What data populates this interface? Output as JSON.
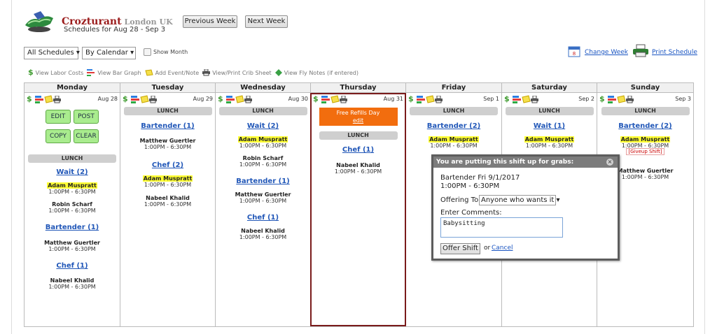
{
  "header": {
    "brand": "Crozturant",
    "location": "London UK",
    "subtitle": "Schedules for Aug 28 - Sep 3",
    "prev_label": "Previous Week",
    "next_label": "Next Week"
  },
  "controls": {
    "schedules_select": "All Schedules",
    "view_select": "By Calendar",
    "show_month_label": "Show Month",
    "change_week_label": "Change Week",
    "print_schedule_label": "Print Schedule"
  },
  "toolbar": {
    "labor": "View Labor Costs",
    "bar": "View Bar Graph",
    "event": "Add Event/Note",
    "crib": "View/Print Crib Sheet",
    "fly": "View Fly Notes (if entered)"
  },
  "days": [
    {
      "name": "Monday",
      "date": "Aug 28"
    },
    {
      "name": "Tuesday",
      "date": "Aug 29"
    },
    {
      "name": "Wednesday",
      "date": "Aug 30"
    },
    {
      "name": "Thursday",
      "date": "Aug 31"
    },
    {
      "name": "Friday",
      "date": "Sep 1"
    },
    {
      "name": "Saturday",
      "date": "Sep 2"
    },
    {
      "name": "Sunday",
      "date": "Sep 3"
    }
  ],
  "lunch": "LUNCH",
  "monday_buttons": {
    "edit": "EDIT",
    "post": "POST",
    "copy": "COPY",
    "clear": "CLEAR"
  },
  "shifts": {
    "mon": {
      "wait": "Wait (2)",
      "e1": "Adam Muspratt",
      "t1": "1:00PM - 6:30PM",
      "e2": "Robin Scharf",
      "t2": "1:00PM - 6:30PM",
      "bart": "Bartender (1)",
      "e3": "Matthew Guertler",
      "t3": "1:00PM - 6:30PM",
      "chef": "Chef (1)",
      "e4": "Nabeel Khalid",
      "t4": "1:00PM - 6:30PM"
    },
    "tue": {
      "bart": "Bartender (1)",
      "e1": "Matthew Guertler",
      "t1": "1:00PM - 6:30PM",
      "chef": "Chef (2)",
      "e2": "Adam Muspratt",
      "t2": "1:00PM - 6:30PM",
      "e3": "Nabeel Khalid",
      "t3": "1:00PM - 6:30PM"
    },
    "wed": {
      "wait": "Wait (2)",
      "e1": "Adam Muspratt",
      "t1": "1:00PM - 6:30PM",
      "e2": "Robin Scharf",
      "t2": "1:00PM - 6:30PM",
      "bart": "Bartender (1)",
      "e3": "Matthew Guertler",
      "t3": "1:00PM - 6:30PM",
      "chef": "Chef (1)",
      "e4": "Nabeel Khalid",
      "t4": "1:00PM - 6:30PM"
    },
    "thu": {
      "event": "Free Refills Day",
      "event_edit": "edit",
      "chef": "Chef (1)",
      "e1": "Nabeel Khalid",
      "t1": "1:00PM - 6:30PM"
    },
    "fri": {
      "bart": "Bartender (2)",
      "e1": "Adam Muspratt",
      "t1": "1:00PM - 6:30PM"
    },
    "sat": {
      "wait": "Wait (1)",
      "e1": "Adam Muspratt",
      "t1": "1:00PM - 6:30PM"
    },
    "sun": {
      "bart": "Bartender (2)",
      "e1": "Adam Muspratt",
      "t1": "1:00PM - 6:30PM",
      "giveup": "[Giveup Shift]",
      "e2": "Matthew Guertler",
      "t2": "1:00PM - 6:30PM"
    }
  },
  "popup": {
    "title": "You are putting this shift up for grabs:",
    "shift_line": "Bartender Fri 9/1/2017",
    "time_line": "1:00PM - 6:30PM",
    "offering_label": "Offering To:",
    "offering_value": "Anyone who wants it",
    "comments_label": "Enter Comments:",
    "comment_value": "Babysitting",
    "offer_button": "Offer Shift",
    "or_text": "or",
    "cancel": "Cancel"
  }
}
